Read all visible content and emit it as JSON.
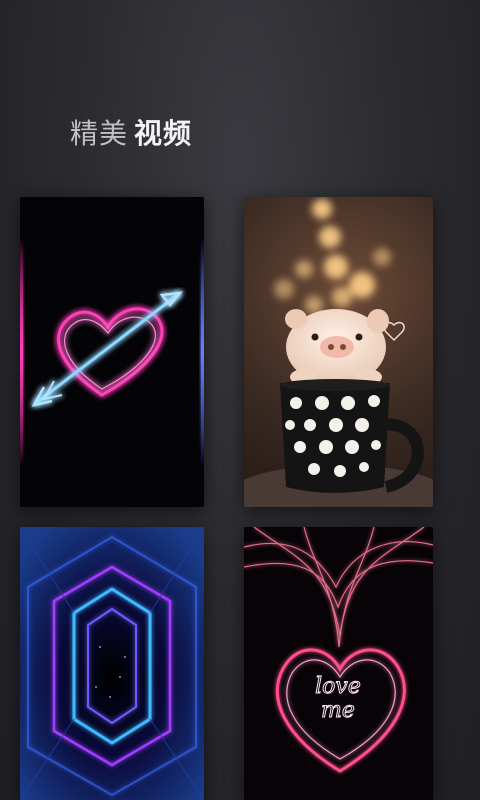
{
  "header": {
    "title_light": "精美",
    "title_bold": "视频"
  },
  "cards": [
    {
      "icon": "neon-heart-arrow-icon"
    },
    {
      "icon": "pig-in-cup-icon"
    },
    {
      "icon": "neon-tunnel-icon"
    },
    {
      "icon": "love-me-heart-icon"
    }
  ],
  "card_text": {
    "love_line1": "love",
    "love_line2": "me"
  },
  "colors": {
    "background": "#2b2b30",
    "title_bold": "#f3f3f6",
    "neon_pink": "#ff3fb8",
    "neon_blue": "#6fc8ff"
  }
}
